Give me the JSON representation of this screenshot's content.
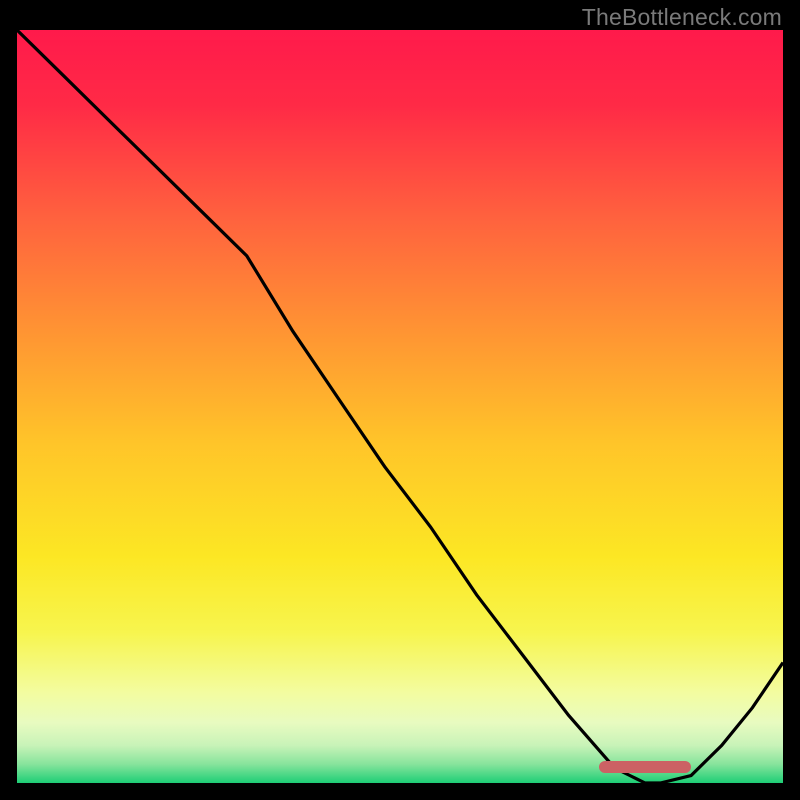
{
  "watermark": "TheBottleneck.com",
  "colors": {
    "plot_border": "#000000",
    "curve": "#000000",
    "marker": "#cc6164"
  },
  "chart_data": {
    "type": "line",
    "title": "",
    "xlabel": "",
    "ylabel": "",
    "xlim": [
      0,
      100
    ],
    "ylim": [
      0,
      100
    ],
    "x": [
      0,
      6,
      12,
      18,
      24,
      30,
      36,
      42,
      48,
      54,
      60,
      66,
      72,
      78,
      80,
      82,
      84,
      88,
      92,
      96,
      100
    ],
    "y": [
      100,
      94,
      88,
      82,
      76,
      70,
      60,
      51,
      42,
      34,
      25,
      17,
      9,
      2,
      1,
      0,
      0,
      1,
      5,
      10,
      16
    ],
    "gradient_stops": [
      {
        "pos": 0.0,
        "color": "#ff1a4b"
      },
      {
        "pos": 0.1,
        "color": "#ff2a46"
      },
      {
        "pos": 0.25,
        "color": "#ff623e"
      },
      {
        "pos": 0.4,
        "color": "#ff9433"
      },
      {
        "pos": 0.55,
        "color": "#ffc529"
      },
      {
        "pos": 0.7,
        "color": "#fce724"
      },
      {
        "pos": 0.8,
        "color": "#f7f54e"
      },
      {
        "pos": 0.88,
        "color": "#f3fca0"
      },
      {
        "pos": 0.92,
        "color": "#e8fbc0"
      },
      {
        "pos": 0.95,
        "color": "#c8f3b8"
      },
      {
        "pos": 0.975,
        "color": "#87e49c"
      },
      {
        "pos": 1.0,
        "color": "#1ece76"
      }
    ],
    "marker": {
      "x_start": 76,
      "x_end": 88,
      "y": 0.5
    }
  }
}
